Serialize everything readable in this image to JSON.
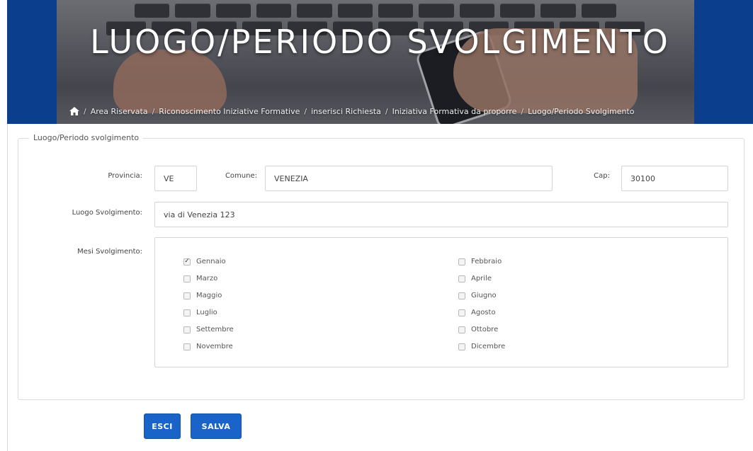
{
  "header": {
    "title": "LUOGO/PERIODO SVOLGIMENTO",
    "breadcrumb": [
      "Area Riservata",
      "Riconoscimento Iniziative Formative",
      "inserisci Richiesta",
      "Iniziativa Formativa da proporre",
      "Luogo/Periodo Svolgimento"
    ],
    "separator": "/",
    "home_icon": "home-icon"
  },
  "form": {
    "legend": "Luogo/Periodo svolgimento",
    "provincia": {
      "label": "Provincia:",
      "value": "VE"
    },
    "comune": {
      "label": "Comune:",
      "value": "VENEZIA"
    },
    "cap": {
      "label": "Cap:",
      "value": "30100"
    },
    "luogo": {
      "label": "Luogo Svolgimento:",
      "value": "via di Venezia 123"
    },
    "mesi": {
      "label": "Mesi Svolgimento:",
      "months": [
        {
          "name": "Gennaio",
          "checked": true
        },
        {
          "name": "Febbraio",
          "checked": false
        },
        {
          "name": "Marzo",
          "checked": false
        },
        {
          "name": "Aprile",
          "checked": false
        },
        {
          "name": "Maggio",
          "checked": false
        },
        {
          "name": "Giugno",
          "checked": false
        },
        {
          "name": "Luglio",
          "checked": false
        },
        {
          "name": "Agosto",
          "checked": false
        },
        {
          "name": "Settembre",
          "checked": false
        },
        {
          "name": "Ottobre",
          "checked": false
        },
        {
          "name": "Novembre",
          "checked": false
        },
        {
          "name": "Dicembre",
          "checked": false
        }
      ]
    }
  },
  "buttons": {
    "esci": "ESCI",
    "salva": "SALVA"
  },
  "colors": {
    "banner_blue": "#0b3e8c",
    "button_blue": "#1a63c9"
  }
}
